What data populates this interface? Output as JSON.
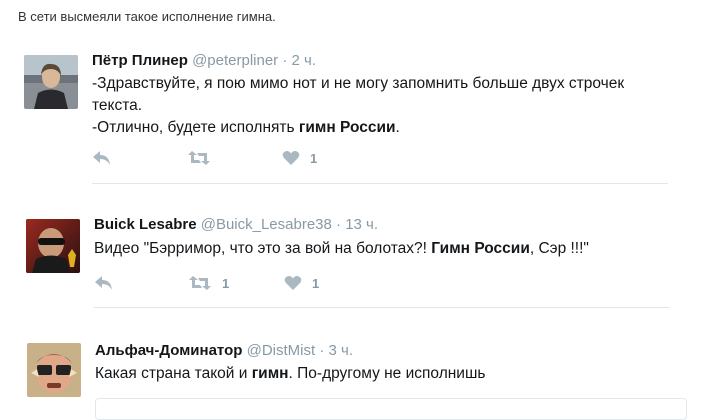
{
  "caption": "В сети высмеяли такое исполнение гимна.",
  "colors": {
    "icon": "#aab8c2",
    "meta": "#8899a6",
    "divider": "#e1e8ed"
  },
  "tweets": [
    {
      "name": "Пётр Плинер",
      "handle": "@peterpliner",
      "separator": "·",
      "time": "2 ч.",
      "lines": [
        {
          "pre": "-Здравствуйте, я пою мимо нот и не могу запомнить больше двух строчек",
          "bold": "",
          "post": ""
        },
        {
          "pre": "текста.",
          "bold": "",
          "post": ""
        },
        {
          "pre": "-Отлично, будете исполнять ",
          "bold": "гимн России",
          "post": "."
        }
      ],
      "retweets": "",
      "likes": "1"
    },
    {
      "name": "Buick Lesabre",
      "handle": "@Buick_Lesabre38",
      "separator": "·",
      "time": "13 ч.",
      "lines": [
        {
          "pre": "Видео \"Бэрримор, что это за вой на болотах?! ",
          "bold": "Гимн России",
          "post": ", Сэр !!!\""
        }
      ],
      "retweets": "1",
      "likes": "1"
    },
    {
      "name": "Альфач-Доминатор",
      "handle": "@DistMist",
      "separator": "·",
      "time": "3 ч.",
      "lines": [
        {
          "pre": "Какая страна такой и ",
          "bold": "гимн",
          "post": ". По-другому не исполнишь"
        }
      ],
      "retweets": "",
      "likes": ""
    }
  ],
  "icons": {
    "reply": "reply-icon",
    "retweet": "retweet-icon",
    "like": "heart-icon"
  }
}
